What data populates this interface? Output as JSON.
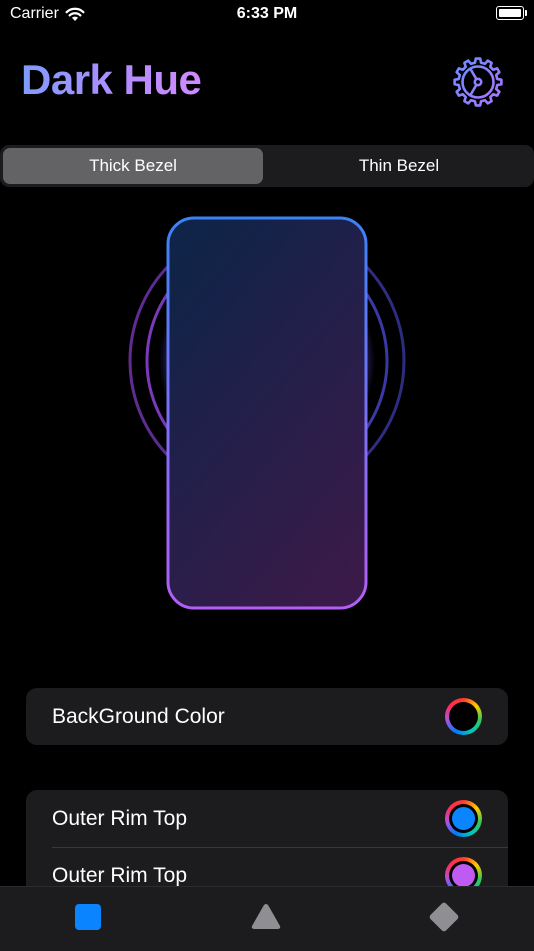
{
  "status_bar": {
    "carrier": "Carrier",
    "time": "6:33 PM"
  },
  "header": {
    "title": "Dark Hue",
    "settings_icon": "gear-icon"
  },
  "bezel_picker": {
    "options": [
      "Thick Bezel",
      "Thin Bezel"
    ],
    "selected": "Thick Bezel"
  },
  "settings_list": {
    "background": {
      "label": "BackGround Color",
      "color": "#000000"
    },
    "rims": [
      {
        "label": "Outer Rim Top",
        "color": "#0a84ff"
      },
      {
        "label": "Outer Rim Top",
        "color": "#bf5af2"
      }
    ]
  },
  "tab_bar": {
    "tabs": [
      {
        "icon": "square-icon",
        "selected": true,
        "color": "#0a84ff"
      },
      {
        "icon": "triangle-icon",
        "selected": false,
        "color": "#8e8e93"
      },
      {
        "icon": "diamond-icon",
        "selected": false,
        "color": "#8e8e93"
      }
    ]
  }
}
